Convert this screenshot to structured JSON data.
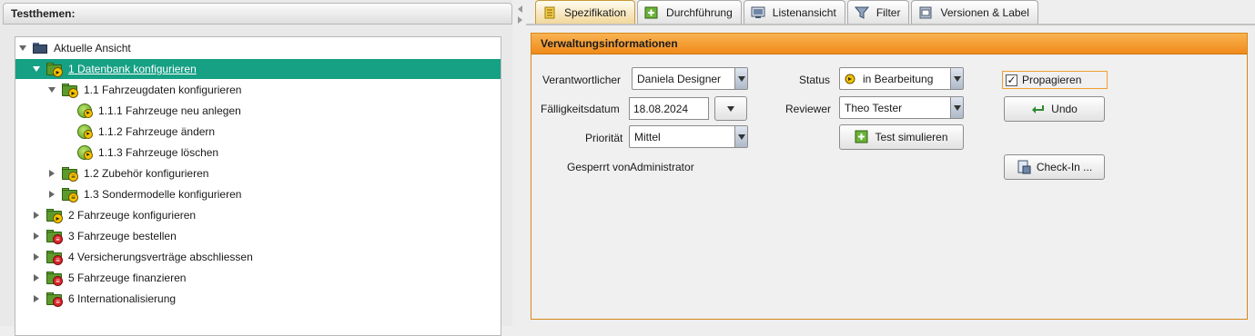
{
  "left_panel": {
    "title": "Testthemen:",
    "tree": [
      {
        "label": "Aktuelle Ansicht",
        "icon": "view-icon",
        "toggle": "expanded",
        "selected": false,
        "kind": "root"
      },
      {
        "label": "1 Datenbank konfigurieren",
        "icon": "folder-pause-icon",
        "toggle": "expanded",
        "selected": true,
        "kind": "folder"
      },
      {
        "label": "1.1 Fahrzeugdaten konfigurieren",
        "icon": "folder-pause-icon",
        "toggle": "expanded",
        "selected": false,
        "kind": "folder"
      },
      {
        "label": "1.1.1 Fahrzeuge neu anlegen",
        "icon": "testcase-icon",
        "toggle": "none",
        "selected": false,
        "kind": "case"
      },
      {
        "label": "1.1.2 Fahrzeuge ändern",
        "icon": "testcase-icon",
        "toggle": "none",
        "selected": false,
        "kind": "case"
      },
      {
        "label": "1.1.3 Fahrzeuge löschen",
        "icon": "testcase-icon",
        "toggle": "none",
        "selected": false,
        "kind": "case"
      },
      {
        "label": "1.2 Zubehör konfigurieren",
        "icon": "folder-doc-icon",
        "toggle": "collapsed",
        "selected": false,
        "kind": "folder"
      },
      {
        "label": "1.3 Sondermodelle konfigurieren",
        "icon": "folder-doc-icon",
        "toggle": "collapsed",
        "selected": false,
        "kind": "folder"
      },
      {
        "label": "2 Fahrzeuge konfigurieren",
        "icon": "folder-pause-icon",
        "toggle": "collapsed",
        "selected": false,
        "kind": "folder"
      },
      {
        "label": "3 Fahrzeuge bestellen",
        "icon": "folder-red-icon",
        "toggle": "collapsed",
        "selected": false,
        "kind": "folder"
      },
      {
        "label": "4 Versicherungsverträge abschliessen",
        "icon": "folder-red-icon",
        "toggle": "collapsed",
        "selected": false,
        "kind": "folder"
      },
      {
        "label": "5 Fahrzeuge finanzieren",
        "icon": "folder-red-icon",
        "toggle": "collapsed",
        "selected": false,
        "kind": "folder"
      },
      {
        "label": "6 Internationalisierung",
        "icon": "folder-red-icon",
        "toggle": "collapsed",
        "selected": false,
        "kind": "folder"
      }
    ]
  },
  "tabs": [
    {
      "label": "Spezifikation",
      "icon": "spec-list-icon",
      "active": true
    },
    {
      "label": "Durchführung",
      "icon": "execution-icon",
      "active": false
    },
    {
      "label": "Listenansicht",
      "icon": "list-view-icon",
      "active": false
    },
    {
      "label": "Filter",
      "icon": "funnel-icon",
      "active": false
    },
    {
      "label": "Versionen & Label",
      "icon": "versions-icon",
      "active": false
    }
  ],
  "admin": {
    "title": "Verwaltungsinformationen",
    "responsible_label": "Verantwortlicher",
    "responsible_value": "Daniela Designer",
    "due_label": "Fälligkeitsdatum",
    "due_value": "18.08.2024",
    "priority_label": "Priorität",
    "priority_value": "Mittel",
    "locked_label": "Gesperrt von",
    "locked_value": "Administrator",
    "status_label": "Status",
    "status_value": "in Bearbeitung",
    "reviewer_label": "Reviewer",
    "reviewer_value": "Theo Tester",
    "simulate_button": "Test simulieren",
    "propagate_label": "Propagieren",
    "propagate_checked": true,
    "undo_button": "Undo",
    "checkin_button": "Check-In ..."
  },
  "colors": {
    "selection": "#16a084",
    "accent_orange": "#f08a1a",
    "folder_green": "#5b9b2d"
  }
}
